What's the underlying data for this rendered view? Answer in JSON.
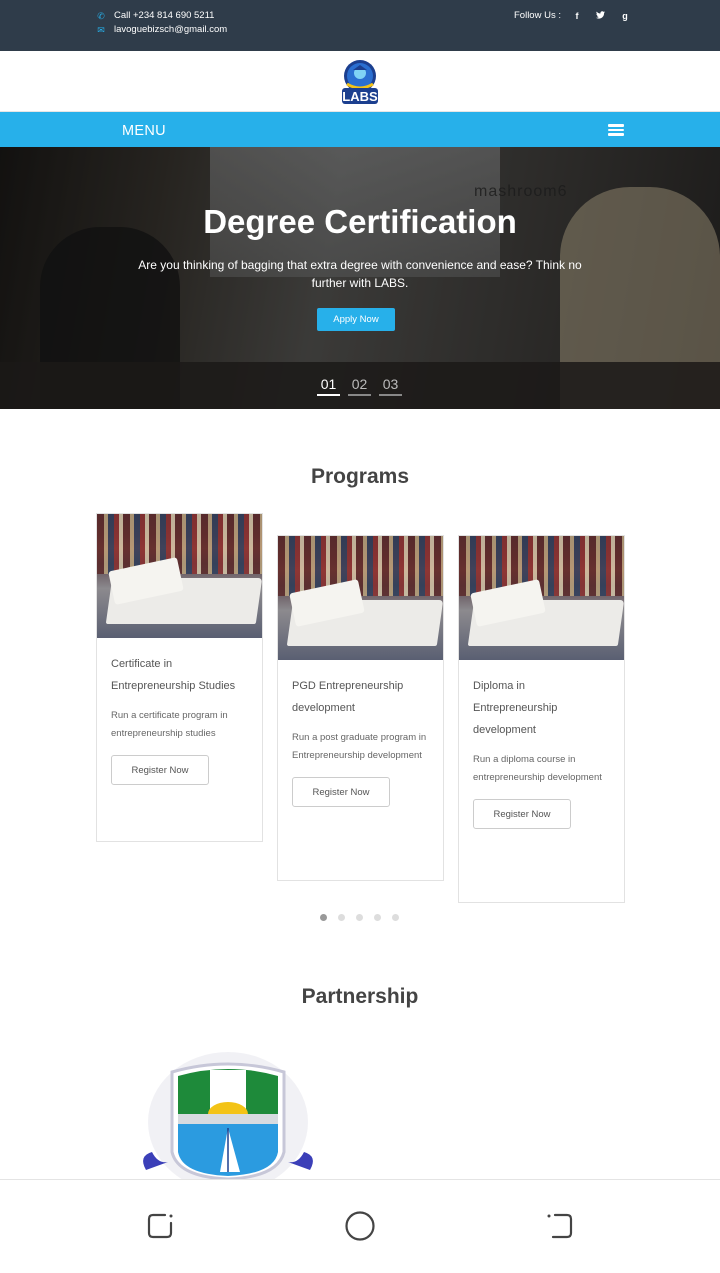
{
  "topbar": {
    "phone": "Call +234 814 690 5211",
    "email": "lavoguebizsch@gmail.com",
    "follow_label": "Follow Us :",
    "social": [
      {
        "icon": "facebook-icon",
        "glyph": "f"
      },
      {
        "icon": "twitter-icon",
        "glyph": "t"
      },
      {
        "icon": "google-plus-icon",
        "glyph": "g"
      }
    ]
  },
  "logo": {
    "text": "LABS"
  },
  "menu": {
    "label": "MENU"
  },
  "hero": {
    "wall_text": "mashroom6",
    "title": "Degree Certification",
    "subtitle": "Are you thinking of bagging that extra degree with convenience and ease? Think no further with LABS.",
    "button": "Apply Now",
    "pages": [
      "01",
      "02",
      "03"
    ]
  },
  "programs": {
    "title": "Programs",
    "cards": [
      {
        "title": "Certificate in Entrepreneurship Studies",
        "desc": "Run a certificate program in entrepreneurship studies",
        "button": "Register Now"
      },
      {
        "title": "PGD Entrepreneurship development",
        "desc": "Run a post graduate program in Entrepreneurship development",
        "button": "Register Now"
      },
      {
        "title": "Diploma in Entrepreneurship development",
        "desc": "Run a diploma course in entrepreneurship development",
        "button": "Register Now"
      }
    ]
  },
  "partnership": {
    "title": "Partnership"
  },
  "colors": {
    "accent": "#27b0ea",
    "topbar": "#2f3c4a"
  }
}
